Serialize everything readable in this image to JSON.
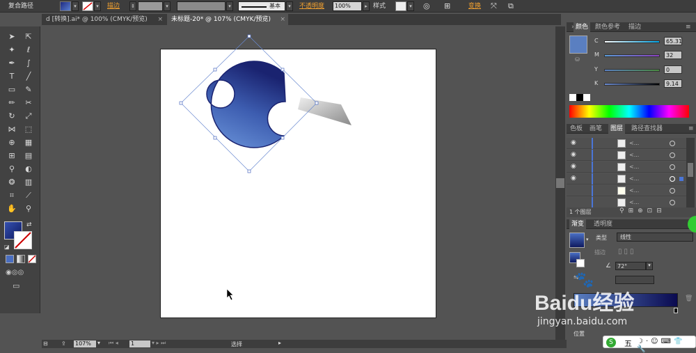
{
  "control_bar": {
    "selection_label": "复合路径",
    "stroke_label": "描边",
    "brush_label": "基本",
    "opacity_label": "不透明度",
    "opacity_value": "100%",
    "style_label": "样式",
    "transform_label": "变换"
  },
  "tabs": [
    {
      "label": "d [转换].ai* @ 100% (CMYK/预览)"
    },
    {
      "label": "未标题-20* @ 107% (CMYK/预览)"
    }
  ],
  "color_panel": {
    "tabs": [
      "颜色",
      "颜色参考",
      "描边"
    ],
    "channels": [
      {
        "name": "C",
        "value": "65.31"
      },
      {
        "name": "M",
        "value": "32"
      },
      {
        "name": "Y",
        "value": "0"
      },
      {
        "name": "K",
        "value": "9.14"
      }
    ]
  },
  "layers_panel": {
    "tabs": [
      "色板",
      "画笔",
      "图层",
      "路径查找器"
    ],
    "rows": [
      "<...",
      "<...",
      "<...",
      "<...",
      "<...",
      "<..."
    ],
    "footer": "1 个图层"
  },
  "gradient_panel": {
    "tabs": [
      "渐变",
      "透明度"
    ],
    "type_label": "类型",
    "type_value": "线性",
    "stroke_label": "描边",
    "angle_value": "72°",
    "location_label": "位置"
  },
  "status_bar": {
    "zoom": "107%",
    "page": "1",
    "tool_status": "选择"
  },
  "watermark": {
    "brand": "Baidu经验",
    "url": "jingyan.baidu.com"
  },
  "taskbar": {
    "ime_label": "五"
  }
}
